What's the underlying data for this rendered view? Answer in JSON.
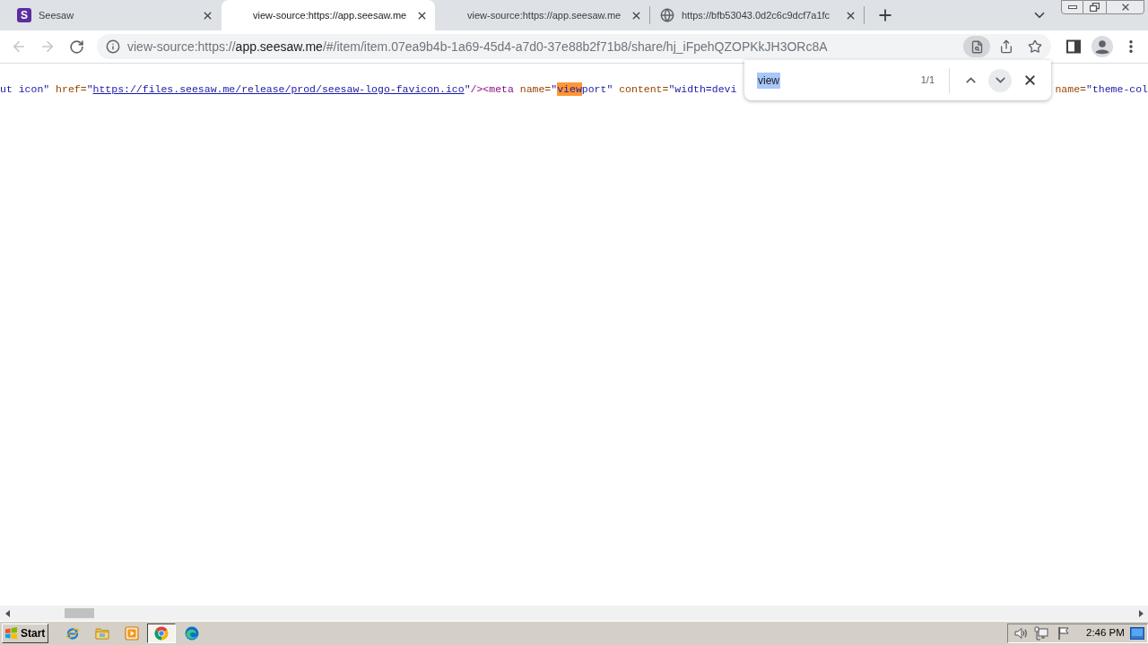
{
  "tabs": [
    {
      "title": "Seesaw",
      "kind": "logo",
      "logo_letter": "S",
      "selected": false
    },
    {
      "title": "view-source:https://app.seesaw.me",
      "kind": "no_icon",
      "selected": true
    },
    {
      "title": "view-source:https://app.seesaw.me",
      "kind": "no_icon",
      "selected": false
    },
    {
      "title": "https://bfb53043.0d2c6c9dcf7a1fc",
      "kind": "globe",
      "selected": false
    }
  ],
  "navigation": {
    "back_enabled": false,
    "forward_enabled": false
  },
  "address_bar": {
    "scheme": "view-source:https://",
    "host": "app.seesaw.me",
    "path": "/#/item/item.07ea9b4b-1a69-45d4-a7d0-37e88b2f71b8/share/hj_iFpehQZOPKkJH3ORc8A",
    "find_active": true
  },
  "find_bar": {
    "query": "view",
    "query_selected": true,
    "count": "1/1",
    "next_highlighted": true
  },
  "source": {
    "visible_start": [
      {
        "kind": "value",
        "text": "ut icon\""
      },
      {
        "kind": "attr",
        "text": " href="
      },
      {
        "kind": "value",
        "text": "\""
      },
      {
        "kind": "link",
        "text": "https://files.seesaw.me/release/prod/seesaw-logo-favicon.ico"
      },
      {
        "kind": "value",
        "text": "\""
      },
      {
        "kind": "tag",
        "text": "/><meta"
      },
      {
        "kind": "attr",
        "text": " name="
      },
      {
        "kind": "value",
        "text": "\""
      },
      {
        "kind": "match",
        "text": "view"
      },
      {
        "kind": "value",
        "text": "port\""
      },
      {
        "kind": "attr",
        "text": " content="
      },
      {
        "kind": "value",
        "text": "\"width=devi"
      }
    ],
    "visible_end": [
      {
        "kind": "attr",
        "text": " name="
      },
      {
        "kind": "value",
        "text": "\"theme-col"
      }
    ]
  },
  "taskbar": {
    "start": "Start",
    "apps": [
      {
        "kind": "ie",
        "active": false
      },
      {
        "kind": "folder",
        "active": false
      },
      {
        "kind": "media",
        "active": false
      },
      {
        "kind": "chrome",
        "active": true
      },
      {
        "kind": "edge",
        "active": false
      }
    ],
    "clock": "2:46 PM"
  }
}
